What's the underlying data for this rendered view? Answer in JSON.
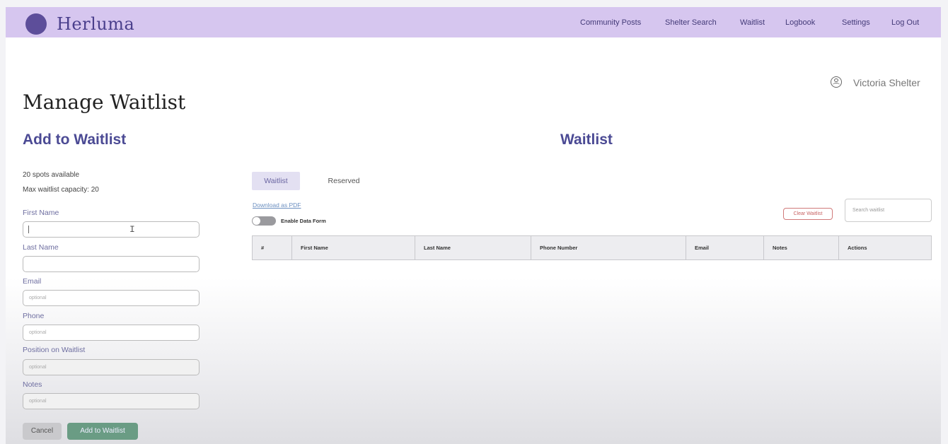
{
  "navbar": {
    "brand": "Herluma",
    "links": [
      "Community Posts",
      "Shelter Search",
      "Waitlist",
      "Logbook",
      "Settings",
      "Log Out"
    ]
  },
  "user": {
    "name": "Victoria Shelter"
  },
  "page_title": "Manage Waitlist",
  "add_form": {
    "title": "Add to Waitlist",
    "spots_available": "20 spots available",
    "max_capacity": "Max waitlist capacity: 20",
    "fields": [
      {
        "label": "First Name",
        "value": "",
        "placeholder": ""
      },
      {
        "label": "Last Name",
        "value": "",
        "placeholder": ""
      },
      {
        "label": "Email",
        "value": "",
        "placeholder": "optional"
      },
      {
        "label": "Phone",
        "value": "",
        "placeholder": "optional"
      },
      {
        "label": "Position on Waitlist",
        "value": "",
        "placeholder": "optional"
      },
      {
        "label": "Notes",
        "value": "",
        "placeholder": "optional"
      }
    ],
    "cancel_label": "Cancel",
    "submit_label": "Add to Waitlist"
  },
  "waitlist": {
    "title": "Waitlist",
    "tabs": [
      {
        "label": "Waitlist",
        "active": true
      },
      {
        "label": "Reserved",
        "active": false
      }
    ],
    "download_label": "Download as PDF",
    "toggle_label": "Enable Data Form",
    "toggle_on": false,
    "clear_label": "Clear Waitlist",
    "search_placeholder": "Search waitlist",
    "columns": [
      "#",
      "First Name",
      "Last Name",
      "Phone Number",
      "Email",
      "Notes",
      "Actions"
    ],
    "rows": []
  },
  "colors": {
    "navbar": "#d6c6ef",
    "brand": "#4a3f8c",
    "accent": "#4b4a94",
    "add_button": "#6a9c84",
    "clear_button": "#d07a7a"
  }
}
